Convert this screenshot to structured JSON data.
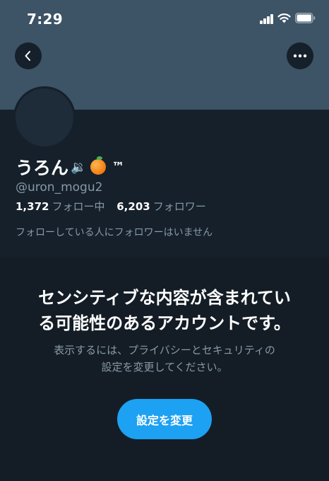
{
  "status_bar": {
    "time": "7:29"
  },
  "header": {
    "back_icon": "chevron-left-icon",
    "more_icon": "ellipsis-icon"
  },
  "profile": {
    "display_name": "うろん",
    "name_emojis": [
      "speaker-emoji",
      "tangerine-emoji"
    ],
    "name_suffix": "™",
    "handle": "@uron_mogu2",
    "following_count": "1,372",
    "following_label": "フォロー中",
    "followers_count": "6,203",
    "followers_label": "フォロワー",
    "mutual_note": "フォローしている人にフォロワーはいません"
  },
  "warning": {
    "title_line1": "センシティブな内容が含まれてい",
    "title_line2": "る可能性のあるアカウントです。",
    "desc_line1": "表示するには、プライバシーとセキュリティの",
    "desc_line2": "設定を変更してください。",
    "button_label": "設定を変更"
  },
  "colors": {
    "background": "#15202b",
    "banner": "#3d5366",
    "warning_background": "#141d26",
    "secondary_text": "#8899a6",
    "accent": "#1da1f2"
  }
}
